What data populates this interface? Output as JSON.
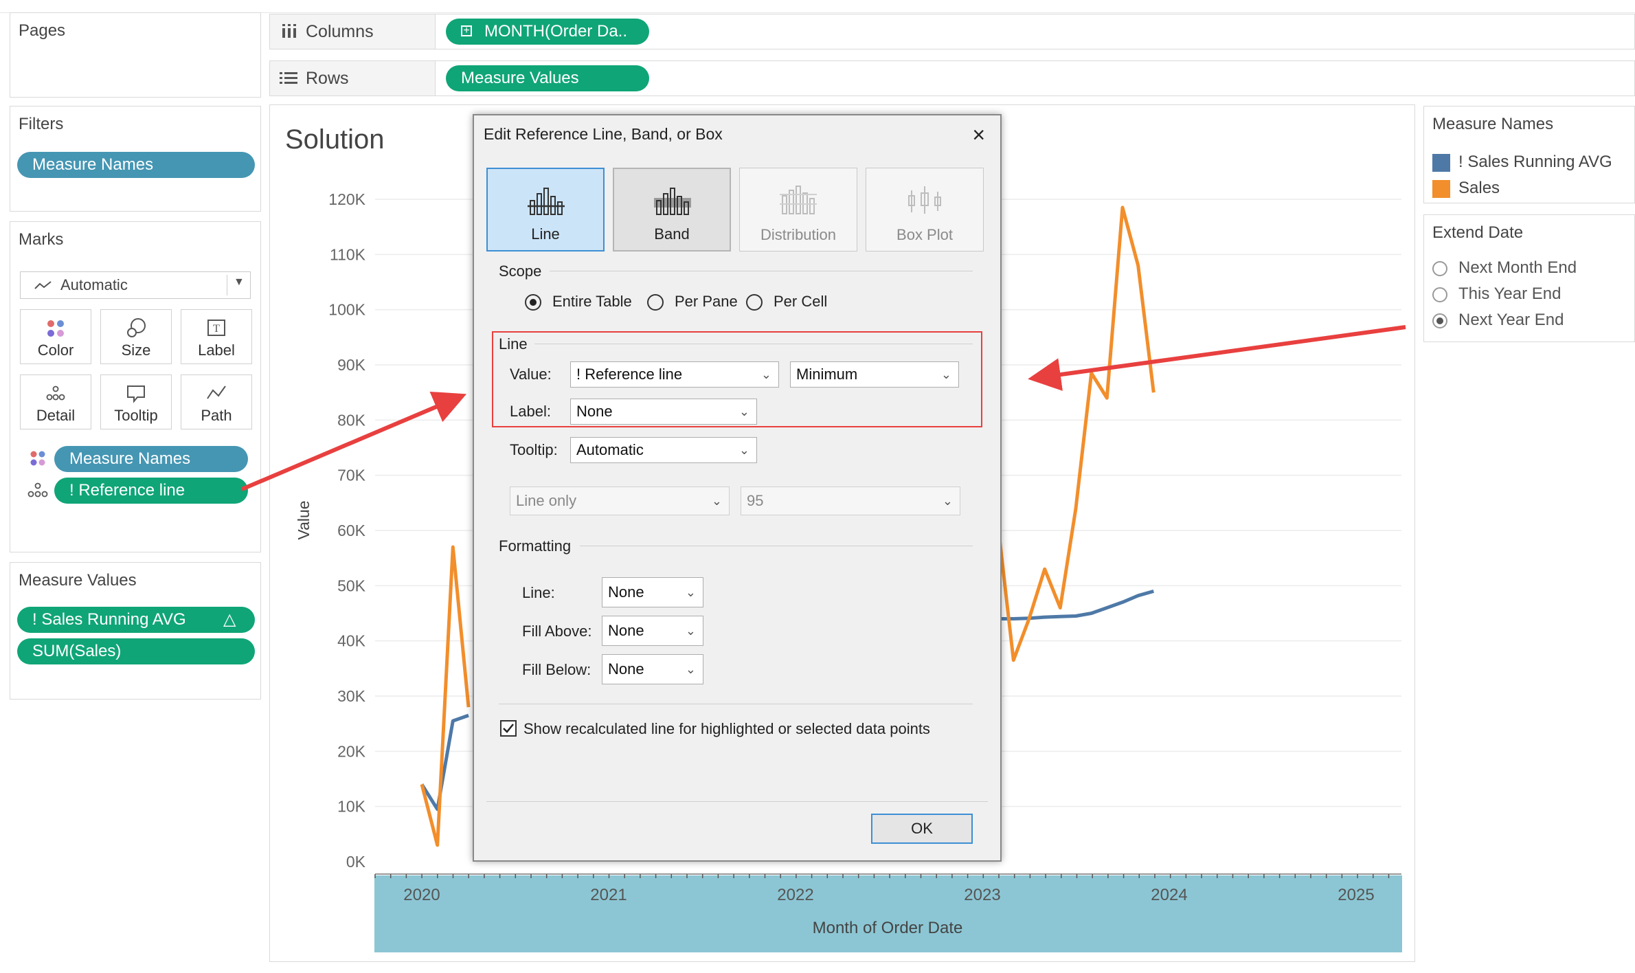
{
  "pages_card": {
    "title": "Pages"
  },
  "filters_card": {
    "title": "Filters",
    "pills": [
      "Measure Names"
    ]
  },
  "marks_card": {
    "title": "Marks",
    "mark_type": "Automatic",
    "buttons": [
      {
        "label": "Color",
        "icon": "color-dots-icon"
      },
      {
        "label": "Size",
        "icon": "size-icon"
      },
      {
        "label": "Label",
        "icon": "label-icon"
      },
      {
        "label": "Detail",
        "icon": "detail-dots-icon"
      },
      {
        "label": "Tooltip",
        "icon": "tooltip-icon"
      },
      {
        "label": "Path",
        "icon": "path-icon"
      }
    ],
    "pills": [
      "Measure Names",
      "! Reference line"
    ]
  },
  "measure_values_card": {
    "title": "Measure Values",
    "pills": [
      "! Sales Running AVG",
      "SUM(Sales)"
    ],
    "delta_symbol": "△"
  },
  "shelves": {
    "columns_label": "Columns",
    "columns_pill": "MONTH(Order Da..",
    "rows_label": "Rows",
    "rows_pill": "Measure Values"
  },
  "worksheet": {
    "title": "Solution"
  },
  "legend": {
    "title": "Measure Names",
    "items": [
      {
        "label": "! Sales Running AVG",
        "color": "#4e79a7"
      },
      {
        "label": "Sales",
        "color": "#f28e2b"
      }
    ]
  },
  "extend_date": {
    "title": "Extend Date",
    "options": [
      "Next Month End",
      "This Year End",
      "Next Year End"
    ],
    "selected": "Next Year End"
  },
  "chart_data": {
    "type": "line",
    "title": "Solution",
    "xlabel": "Month of Order Date",
    "ylabel": "Value",
    "x_ticks": [
      "2020",
      "2021",
      "2022",
      "2023",
      "2024",
      "2025"
    ],
    "y_ticks": [
      "0K",
      "10K",
      "20K",
      "30K",
      "40K",
      "50K",
      "60K",
      "70K",
      "80K",
      "90K",
      "100K",
      "110K",
      "120K"
    ],
    "ylim": [
      0,
      120000
    ],
    "xlim": [
      "2019-12",
      "2025-06"
    ],
    "series": [
      {
        "name": "! Sales Running AVG",
        "color": "#4e79a7",
        "x": [
          "2020-01",
          "2020-02",
          "2020-03",
          "2020-04",
          "2023-01",
          "2023-02",
          "2023-03",
          "2023-04",
          "2023-05",
          "2023-06",
          "2023-07",
          "2023-08",
          "2023-09",
          "2023-10",
          "2023-11",
          "2023-12"
        ],
        "values": [
          14000,
          9500,
          25500,
          26500,
          43800,
          44000,
          44000,
          44100,
          44300,
          44400,
          44500,
          45000,
          46000,
          47000,
          48200,
          49000
        ]
      },
      {
        "name": "Sales",
        "color": "#f28e2b",
        "x": [
          "2020-01",
          "2020-02",
          "2020-03",
          "2020-04",
          "2023-01",
          "2023-02",
          "2023-03",
          "2023-04",
          "2023-05",
          "2023-06",
          "2023-07",
          "2023-08",
          "2023-09",
          "2023-10",
          "2023-11",
          "2023-12"
        ],
        "values": [
          14000,
          3000,
          57000,
          28000,
          21000,
          61000,
          36500,
          44000,
          53000,
          46000,
          64000,
          88500,
          84000,
          118500,
          108000,
          85000
        ]
      }
    ]
  },
  "dialog": {
    "title": "Edit Reference Line, Band, or Box",
    "close": "×",
    "types": [
      "Line",
      "Band",
      "Distribution",
      "Box Plot"
    ],
    "scope_label": "Scope",
    "scope_options": [
      "Entire Table",
      "Per Pane",
      "Per Cell"
    ],
    "scope_selected": "Entire Table",
    "line_section": "Line",
    "value_label": "Value:",
    "value_field": "! Reference line",
    "value_agg": "Minimum",
    "label_label": "Label:",
    "label_value": "None",
    "tooltip_label": "Tooltip:",
    "tooltip_value": "Automatic",
    "ci_type": "Line only",
    "ci_value": "95",
    "formatting_label": "Formatting",
    "fmt_line_label": "Line:",
    "fmt_line_value": "None",
    "fill_above_label": "Fill Above:",
    "fill_above_value": "None",
    "fill_below_label": "Fill Below:",
    "fill_below_value": "None",
    "recalc_label": "Show recalculated line for highlighted or selected data points",
    "recalc_checked": true,
    "ok_label": "OK"
  },
  "annotation_color": "#e8403f"
}
